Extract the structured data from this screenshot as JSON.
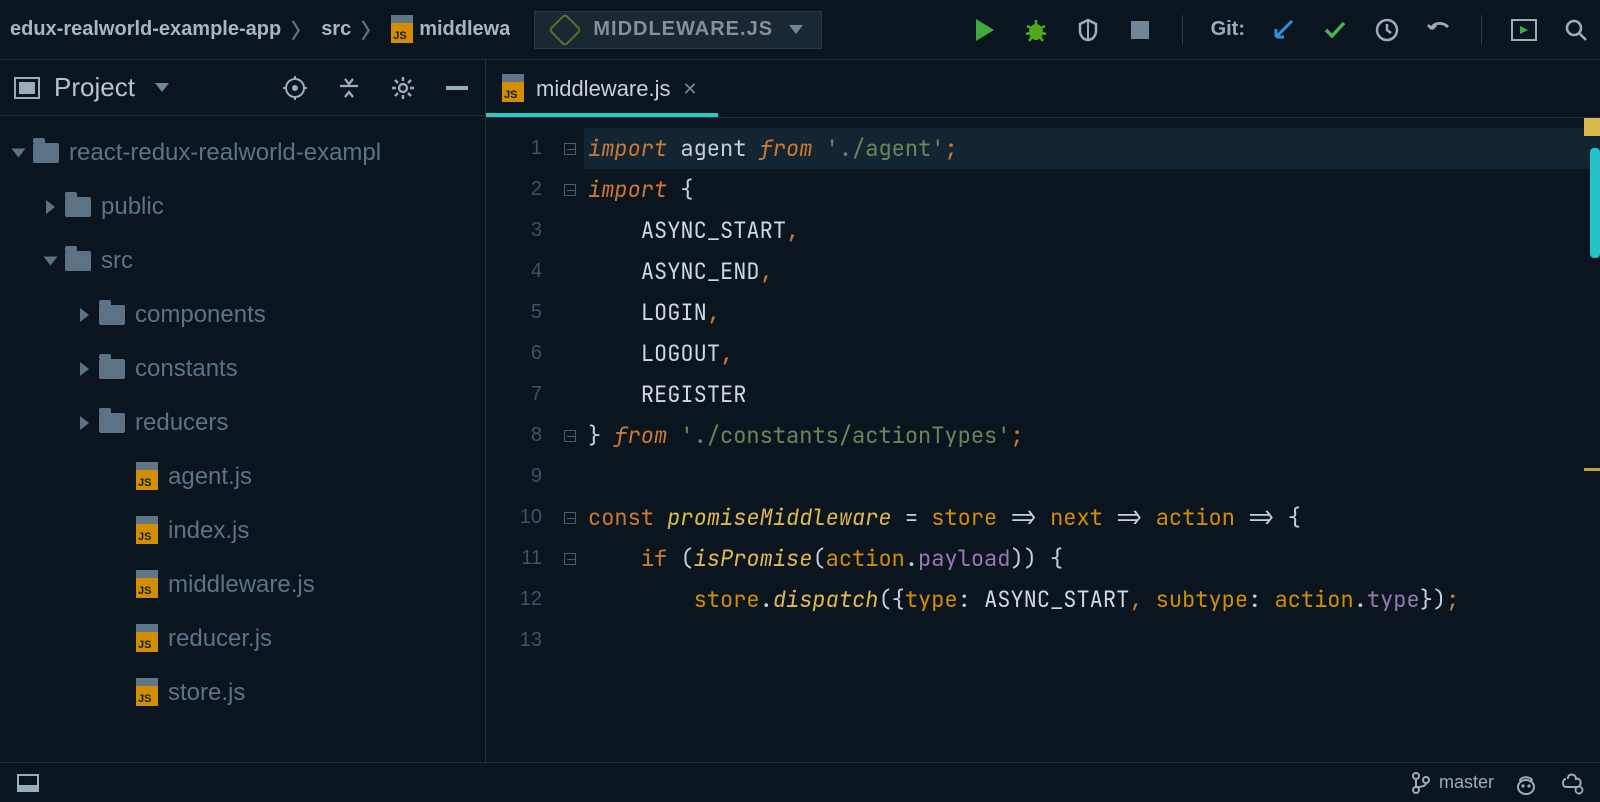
{
  "breadcrumbs": {
    "root": "edux-realworld-example-app",
    "mid": "src",
    "leaf": "middlewa"
  },
  "run_config": {
    "name": "MIDDLEWARE.JS"
  },
  "git_label": "Git:",
  "project_panel": {
    "title": "Project"
  },
  "tree": [
    {
      "depth": 0,
      "open": true,
      "type": "folder",
      "label": "react-redux-realworld-exampl"
    },
    {
      "depth": 1,
      "open": false,
      "type": "folder",
      "label": "public"
    },
    {
      "depth": 1,
      "open": true,
      "type": "folder",
      "label": "src"
    },
    {
      "depth": 2,
      "open": false,
      "type": "folder",
      "label": "components"
    },
    {
      "depth": 2,
      "open": false,
      "type": "folder",
      "label": "constants"
    },
    {
      "depth": 2,
      "open": false,
      "type": "folder",
      "label": "reducers"
    },
    {
      "depth": 3,
      "open": null,
      "type": "js",
      "label": "agent.js"
    },
    {
      "depth": 3,
      "open": null,
      "type": "js",
      "label": "index.js"
    },
    {
      "depth": 3,
      "open": null,
      "type": "js",
      "label": "middleware.js"
    },
    {
      "depth": 3,
      "open": null,
      "type": "js",
      "label": "reducer.js"
    },
    {
      "depth": 3,
      "open": null,
      "type": "js",
      "label": "store.js"
    }
  ],
  "tab": {
    "file": "middleware.js"
  },
  "code": {
    "lines": [
      1,
      2,
      3,
      4,
      5,
      6,
      7,
      8,
      9,
      10,
      11,
      12,
      13
    ],
    "text": [
      "import agent from './agent';",
      "import {",
      "    ASYNC_START,",
      "    ASYNC_END,",
      "    LOGIN,",
      "    LOGOUT,",
      "    REGISTER",
      "} from './constants/actionTypes';",
      "",
      "const promiseMiddleware = store => next => action => {",
      "    if (isPromise(action.payload)) {",
      "        store.dispatch({type: ASYNC_START, subtype: action.type});",
      ""
    ]
  },
  "status": {
    "branch": "master"
  }
}
